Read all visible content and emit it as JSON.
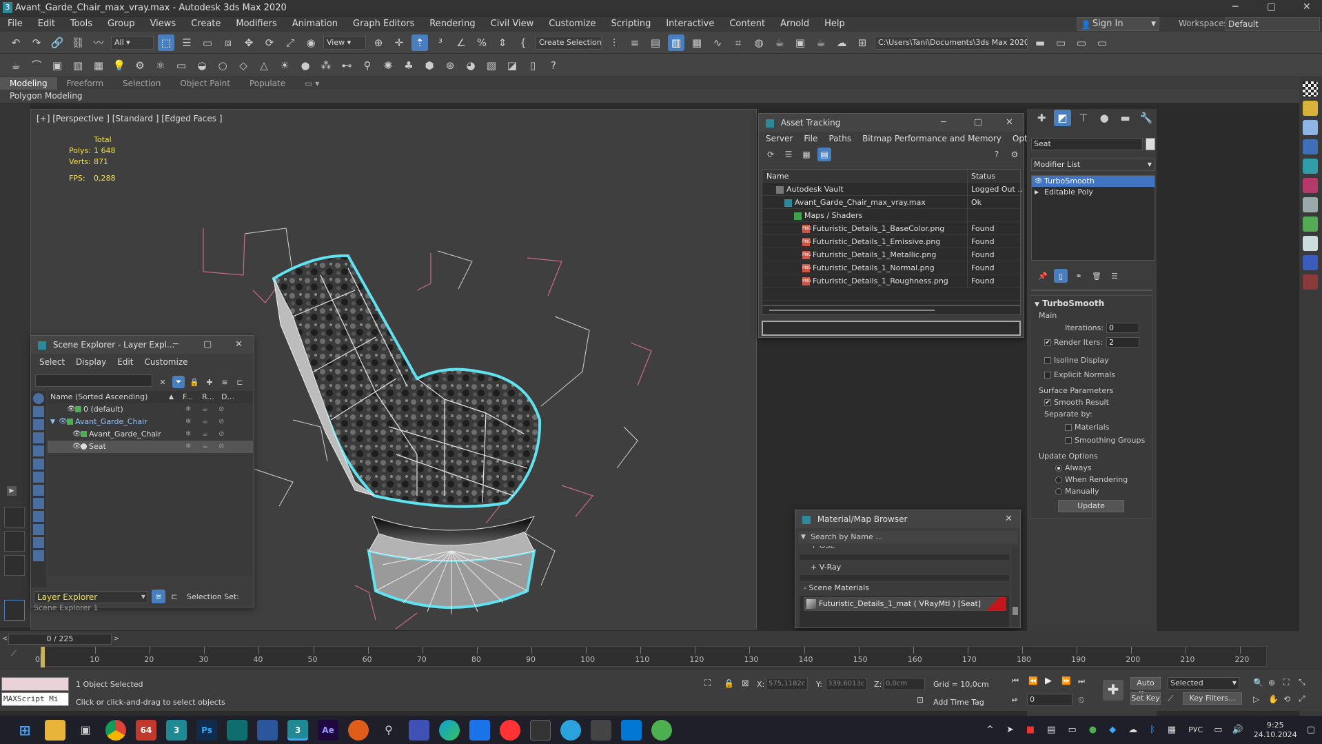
{
  "window": {
    "title": "Avant_Garde_Chair_max_vray.max - Autodesk 3ds Max 2020",
    "app_icon": "3",
    "min": "─",
    "max": "▢",
    "close": "✕"
  },
  "menu": [
    "File",
    "Edit",
    "Tools",
    "Group",
    "Views",
    "Create",
    "Modifiers",
    "Animation",
    "Graph Editors",
    "Rendering",
    "Civil View",
    "Customize",
    "Scripting",
    "Interactive",
    "Content",
    "Arnold",
    "Help"
  ],
  "account": {
    "sign_in": "Sign In",
    "workspaces_label": "Workspaces:",
    "workspace": "Default"
  },
  "toolbar1": {
    "filter": "All",
    "view": "View",
    "selection_set": "Create Selection Se",
    "path": "C:\\Users\\Tani\\Documents\\3ds Max 2020"
  },
  "ribbon": {
    "tabs": [
      "Modeling",
      "Freeform",
      "Selection",
      "Object Paint",
      "Populate"
    ],
    "sub": "Polygon Modeling"
  },
  "viewport": {
    "label": "[+] [Perspective ] [Standard ] [Edged Faces ]",
    "total": "Total",
    "polys_label": "Polys:",
    "polys": "1 648",
    "verts_label": "Verts:",
    "verts": "871",
    "fps_label": "FPS:",
    "fps": "0,288"
  },
  "asset": {
    "title": "Asset Tracking",
    "menu": [
      "Server",
      "File",
      "Paths",
      "Bitmap Performance and Memory",
      "Options"
    ],
    "col_name": "Name",
    "col_status": "Status",
    "rows": [
      {
        "name": "Autodesk Vault",
        "status": "Logged Out ..",
        "indent": 20
      },
      {
        "name": "Avant_Garde_Chair_max_vray.max",
        "status": "Ok",
        "indent": 32
      },
      {
        "name": "Maps / Shaders",
        "status": "",
        "indent": 46
      },
      {
        "name": "Futuristic_Details_1_BaseColor.png",
        "status": "Found",
        "indent": 58
      },
      {
        "name": "Futuristic_Details_1_Emissive.png",
        "status": "Found",
        "indent": 58
      },
      {
        "name": "Futuristic_Details_1_Metallic.png",
        "status": "Found",
        "indent": 58
      },
      {
        "name": "Futuristic_Details_1_Normal.png",
        "status": "Found",
        "indent": 58
      },
      {
        "name": "Futuristic_Details_1_Roughness.png",
        "status": "Found",
        "indent": 58
      }
    ]
  },
  "scene": {
    "title": "Scene Explorer - Layer Expl...",
    "menu": [
      "Select",
      "Display",
      "Edit",
      "Customize"
    ],
    "col_name": "Name (Sorted Ascending)",
    "col_f": "F...",
    "col_r": "R...",
    "col_d": "D...",
    "rows": [
      {
        "name": "0 (default)",
        "indent": 50,
        "sel": false
      },
      {
        "name": "Avant_Garde_Chair",
        "indent": 38,
        "sel": true
      },
      {
        "name": "Avant_Garde_Chair",
        "indent": 58,
        "sel": false
      },
      {
        "name": "Seat",
        "indent": 58,
        "sel": false
      }
    ],
    "footer_dd": "Layer Explorer",
    "footer_dd2": "Scene Explorer 1",
    "sel_set": "Selection Set:"
  },
  "command": {
    "obj_name": "Seat",
    "modifier_list": "Modifier List",
    "stack": [
      "TurboSmooth",
      "Editable Poly"
    ],
    "ts": {
      "title": "TurboSmooth",
      "main": "Main",
      "iterations_label": "Iterations:",
      "iterations": "0",
      "render_label": "Render Iters:",
      "render": "2",
      "isoline": "Isoline Display",
      "explicit": "Explicit Normals",
      "surface": "Surface Parameters",
      "smooth": "Smooth Result",
      "sep": "Separate by:",
      "materials": "Materials",
      "smoothing": "Smoothing Groups",
      "update_opts": "Update Options",
      "always": "Always",
      "when": "When Rendering",
      "manually": "Manually",
      "update": "Update"
    }
  },
  "material": {
    "title": "Material/Map Browser",
    "search": "Search by Name ...",
    "sec1": "+ OSL",
    "sec2": "+ V-Ray",
    "sec3": "- Scene Materials",
    "item": "Futuristic_Details_1_mat  ( VRayMtl )  [Seat]"
  },
  "timeline": {
    "frame": "0 / 225",
    "ticks": [
      "0",
      "10",
      "20",
      "30",
      "40",
      "50",
      "60",
      "70",
      "80",
      "90",
      "100",
      "110",
      "120",
      "130",
      "140",
      "150",
      "160",
      "170",
      "180",
      "190",
      "200",
      "210",
      "220"
    ]
  },
  "status": {
    "selected": "1 Object Selected",
    "hint": "Click or click-and-drag to select objects",
    "maxscript": "MAXScript Mi",
    "x_label": "X:",
    "x": "575,1182c",
    "y_label": "Y:",
    "y": "339,6013c",
    "z_label": "Z:",
    "z": "0,0cm",
    "grid": "Grid = 10,0cm",
    "add_time": "Add Time Tag",
    "auto_key": "Auto Key",
    "set_key": "Set Key",
    "selected_dd": "Selected",
    "key_filters": "Key Filters...",
    "frame_spin": "0"
  },
  "taskbar": {
    "lang": "РУС",
    "time": "9:25",
    "date": "24.10.2024",
    "apps": [
      "64",
      "3",
      "Ps",
      "Ae"
    ]
  },
  "colors": {
    "accent": "#4a7fbf",
    "selection": "#3f75c2",
    "cyan_outline": "#5fe3f0"
  }
}
